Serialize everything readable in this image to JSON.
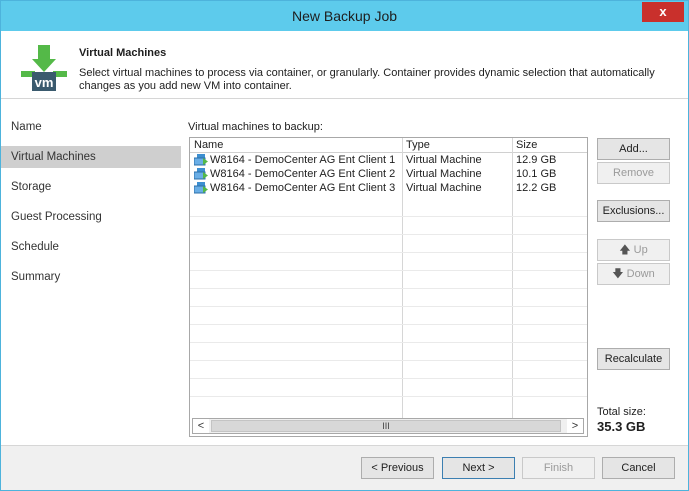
{
  "window": {
    "title": "New Backup Job",
    "close_label": "x"
  },
  "header": {
    "title": "Virtual Machines",
    "description": "Select virtual machines to process via container, or granularly. Container provides dynamic selection that automatically changes as you add new VM into container.",
    "logo_text": "vm"
  },
  "sidebar": {
    "items": [
      {
        "label": "Name",
        "active": false
      },
      {
        "label": "Virtual Machines",
        "active": true
      },
      {
        "label": "Storage",
        "active": false
      },
      {
        "label": "Guest Processing",
        "active": false
      },
      {
        "label": "Schedule",
        "active": false
      },
      {
        "label": "Summary",
        "active": false
      }
    ]
  },
  "grid": {
    "label": "Virtual machines to backup:",
    "columns": [
      "Name",
      "Type",
      "Size"
    ],
    "rows": [
      {
        "name": "W8164 - DemoCenter AG Ent Client 1",
        "type": "Virtual Machine",
        "size": "12.9 GB"
      },
      {
        "name": "W8164 - DemoCenter AG Ent Client 2",
        "type": "Virtual Machine",
        "size": "10.1 GB"
      },
      {
        "name": "W8164 - DemoCenter AG Ent Client 3",
        "type": "Virtual Machine",
        "size": "12.2 GB"
      }
    ],
    "scroll_left": "<",
    "scroll_right": ">",
    "scroll_thumb": "III"
  },
  "buttons": {
    "add": "Add...",
    "remove": "Remove",
    "exclusions": "Exclusions...",
    "up": "Up",
    "down": "Down",
    "recalculate": "Recalculate"
  },
  "total": {
    "label": "Total size:",
    "value": "35.3 GB"
  },
  "footer": {
    "previous": "< Previous",
    "next": "Next >",
    "finish": "Finish",
    "cancel": "Cancel"
  },
  "colors": {
    "titlebar": "#5dcbec",
    "close": "#c9302c",
    "active_nav": "#cfcfcf",
    "logo_green": "#54b948"
  }
}
